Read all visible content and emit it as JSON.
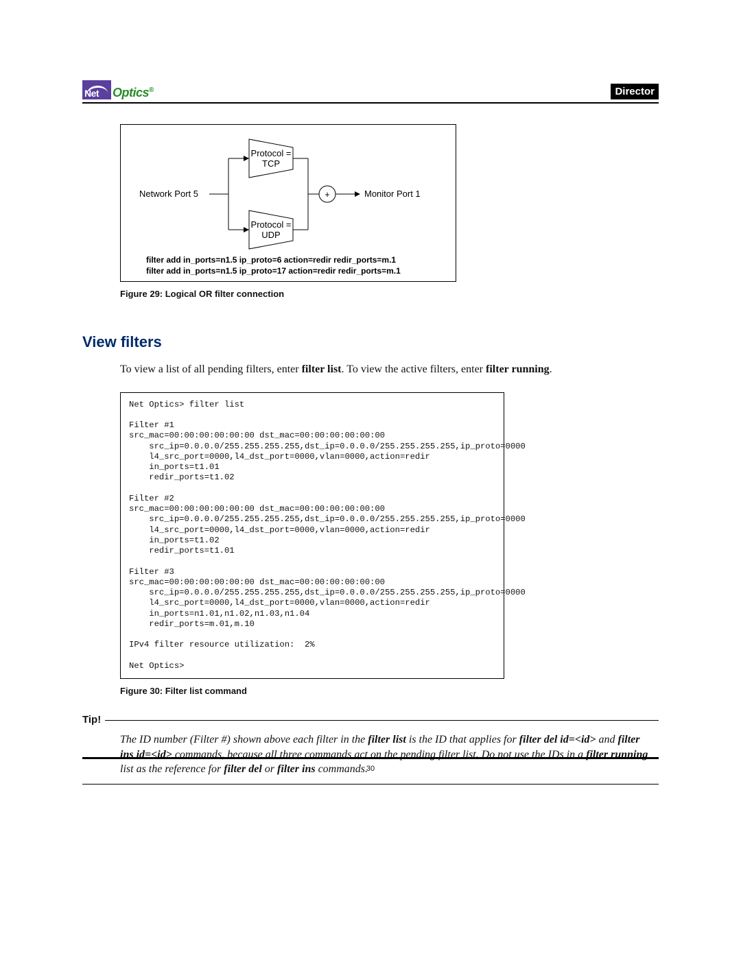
{
  "header": {
    "logo_net": "Net",
    "logo_optics": "Optics",
    "logo_reg": "®",
    "badge": "Director"
  },
  "figure29": {
    "network_port": "Network Port 5",
    "monitor_port": "Monitor Port 1",
    "protocol_top_1": "Protocol =",
    "protocol_top_2": "TCP",
    "protocol_bot_1": "Protocol =",
    "protocol_bot_2": "UDP",
    "plus": "+",
    "cmd1": "filter add in_ports=n1.5 ip_proto=6 action=redir redir_ports=m.1",
    "cmd2": "filter add in_ports=n1.5 ip_proto=17 action=redir redir_ports=m.1",
    "caption": "Figure 29: Logical OR filter connection"
  },
  "section_heading": "View filters",
  "intro_sentence": {
    "p1": "To view a list of all pending filters, enter ",
    "b1": "filter list",
    "p2": ". To view the active filters, enter ",
    "b2": "filter running",
    "p3": "."
  },
  "listing": "Net Optics> filter list\n\nFilter #1\nsrc_mac=00:00:00:00:00:00 dst_mac=00:00:00:00:00:00\n    src_ip=0.0.0.0/255.255.255.255,dst_ip=0.0.0.0/255.255.255.255,ip_proto=0000\n    l4_src_port=0000,l4_dst_port=0000,vlan=0000,action=redir\n    in_ports=t1.01\n    redir_ports=t1.02\n\nFilter #2\nsrc_mac=00:00:00:00:00:00 dst_mac=00:00:00:00:00:00\n    src_ip=0.0.0.0/255.255.255.255,dst_ip=0.0.0.0/255.255.255.255,ip_proto=0000\n    l4_src_port=0000,l4_dst_port=0000,vlan=0000,action=redir\n    in_ports=t1.02\n    redir_ports=t1.01\n\nFilter #3\nsrc_mac=00:00:00:00:00:00 dst_mac=00:00:00:00:00:00\n    src_ip=0.0.0.0/255.255.255.255,dst_ip=0.0.0.0/255.255.255.255,ip_proto=0000\n    l4_src_port=0000,l4_dst_port=0000,vlan=0000,action=redir\n    in_ports=n1.01,n1.02,n1.03,n1.04\n    redir_ports=m.01,m.10\n\nIPv4 filter resource utilization:  2%\n\nNet Optics>",
  "figure30_caption": "Figure 30: Filter list command",
  "tip": {
    "label": "Tip!",
    "body": {
      "p1": "The ID number (Filter #) shown above each filter in the ",
      "b1": "filter list",
      "p2": " is the ID that applies for ",
      "b2": "filter del id=<id>",
      "p3": " and ",
      "b3": "filter ins id=<id>",
      "p4": " commands, because all three commands act on the pending filter list. Do not use the IDs in a ",
      "b4": "filter running",
      "p5": " list as the reference for ",
      "b5": "filter del",
      "p6": " or ",
      "b6": "filter ins",
      "p7": " commands."
    }
  },
  "page_number": "30"
}
